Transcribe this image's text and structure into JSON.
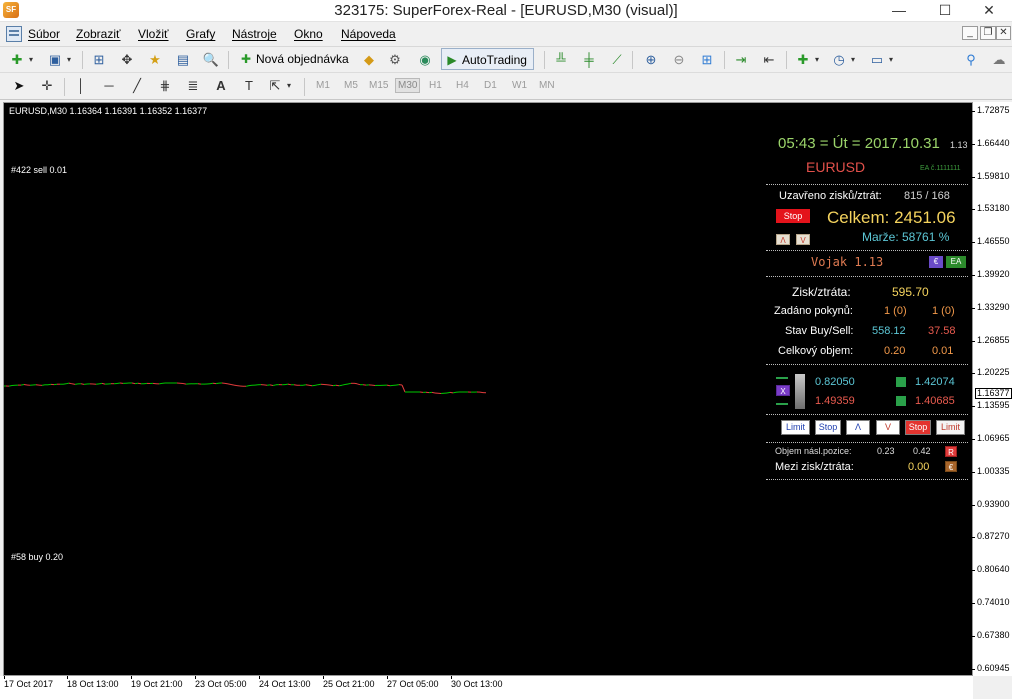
{
  "window": {
    "title": "323175: SuperForex-Real - [EURUSD,M30 (visual)]",
    "app_icon_text": "SF",
    "minimize": "—",
    "maximize": "☐",
    "close": "✕"
  },
  "menu": {
    "items": [
      "Súbor",
      "Zobraziť",
      "Vložiť",
      "Grafy",
      "Nástroje",
      "Okno",
      "Nápoveda"
    ],
    "mdi_minimize": "_",
    "mdi_restore": "❐",
    "mdi_close": "✕"
  },
  "toolbar": {
    "new_order_label": "Nová objednávka",
    "autotrading_label": "AutoTrading",
    "timeframes": [
      "M1",
      "M5",
      "M15",
      "M30",
      "H1",
      "H4",
      "D1",
      "W1",
      "MN"
    ],
    "active_timeframe": "M30"
  },
  "chart": {
    "header": "EURUSD,M30  1.16364 1.16391 1.16352 1.16377",
    "order_sell_label": "#422 sell 0.01",
    "order_buy_label": "#58 buy 0.20",
    "current_price": "1.16377",
    "price_ticks": [
      "1.72875",
      "1.66440",
      "1.59810",
      "1.53180",
      "1.46550",
      "1.39920",
      "1.33290",
      "1.26855",
      "1.20225",
      "1.13595",
      "1.06965",
      "1.00335",
      "0.93900",
      "0.87270",
      "0.80640",
      "0.74010",
      "0.67380",
      "0.60945"
    ],
    "time_ticks": [
      "17 Oct 2017",
      "18 Oct 13:00",
      "19 Oct 21:00",
      "23 Oct 05:00",
      "24 Oct 13:00",
      "25 Oct 21:00",
      "27 Oct 05:00",
      "30 Oct 13:00"
    ],
    "line_colors": {
      "up": "#00c800",
      "down": "#e23c3c"
    }
  },
  "ea_panel": {
    "clock": "05:43 = Út = 2017.10.31",
    "version_small": "1.13",
    "symbol": "EURUSD",
    "ea_id": "EA č.1111111",
    "closed_pl_label": "Uzavřeno zisků/ztrát:",
    "closed_pl_value": "815 / 168",
    "stop_label": "Stop",
    "celkem": "Celkem: 2451.06",
    "up_btn": "Λ",
    "down_btn": "V",
    "marze": "Marže: 58761 %",
    "vojak": "Vojak 1.13",
    "euro_tag": "€",
    "ea_tag": "EA",
    "pl_label": "Zisk/ztráta:",
    "pl_value": "595.70",
    "orders_label": "Zadáno pokynů:",
    "orders_buy": "1 (0)",
    "orders_sell": "1 (0)",
    "state_label": "Stav Buy/Sell:",
    "state_buy": "558.12",
    "state_sell": "37.58",
    "volume_label": "Celkový objem:",
    "volume_buy": "0.20",
    "volume_sell": "0.01",
    "x_tag": "X",
    "price_buy_1": "0.82050",
    "price_sell_1": "1.49359",
    "price_buy_2": "1.42074",
    "price_sell_2": "1.40685",
    "buttons": [
      "Limit",
      "Stop",
      "Λ",
      "V",
      "Stop",
      "Limit"
    ],
    "next_volume_label": "Objem násl.pozice:",
    "next_volume_buy": "0.23",
    "next_volume_sell": "0.42",
    "r_tag": "R",
    "between_label": "Mezi zisk/ztráta:",
    "between_value": "0.00",
    "euro_tag2": "€"
  }
}
